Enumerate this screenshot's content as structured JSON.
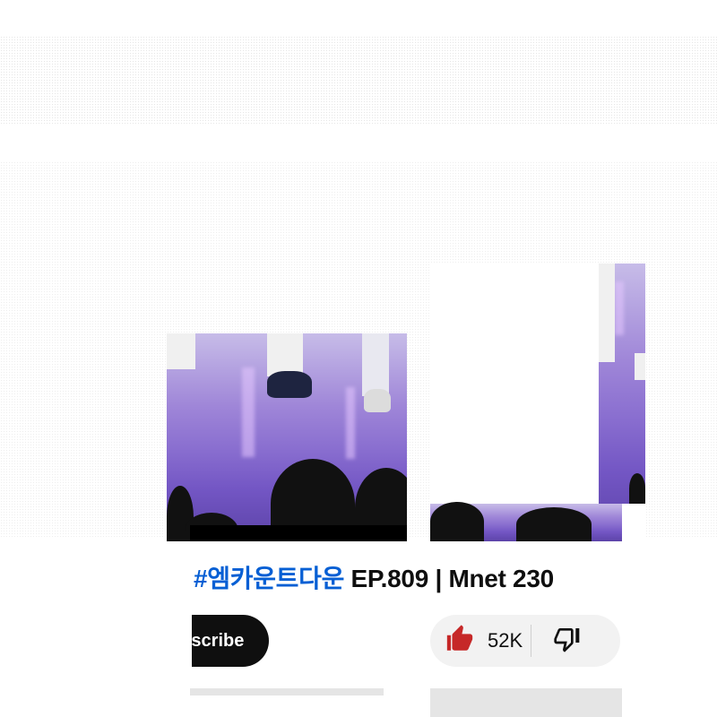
{
  "video": {
    "title_hashtag": "#엠카운트다운",
    "title_rest": " EP.809 | Mnet 230"
  },
  "channel": {
    "subscribe_label": "Subscribe"
  },
  "actions": {
    "like_count": "52K"
  },
  "icons": {
    "like": "thumbs-up-icon",
    "dislike": "thumbs-down-icon"
  },
  "colors": {
    "hashtag": "#065fd4",
    "like_icon": "#c62828",
    "subscribe_bg": "#0f0f0f",
    "pill_bg": "#f2f2f2"
  }
}
